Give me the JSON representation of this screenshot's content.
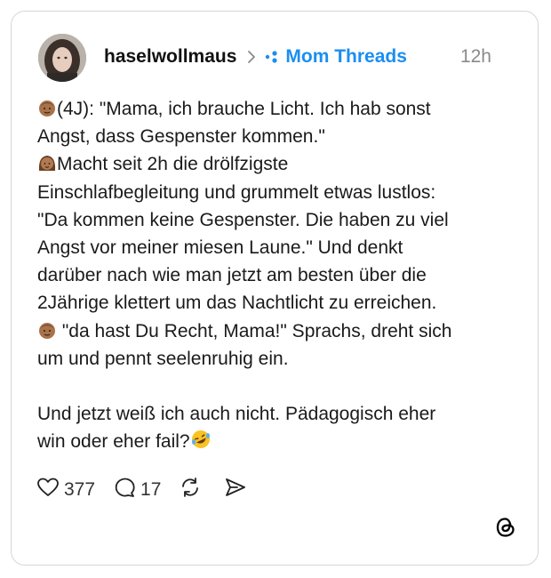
{
  "post": {
    "username": "haselwollmaus",
    "topic": "Mom Threads",
    "time": "12h",
    "text": {
      "l1": "(4J): \"Mama, ich brauche Licht. Ich hab sonst",
      "l2": "Angst, dass Gespenster kommen.\"",
      "l3": "Macht seit 2h die drölfzigste",
      "l4": "Einschlafbegleitung und grummelt etwas lustlos:",
      "l5": "\"Da kommen keine Gespenster. Die haben zu viel",
      "l6": "Angst vor meiner miesen Laune.\" Und denkt",
      "l7": "darüber nach wie man jetzt am besten über die",
      "l8": "2Jährige klettert um das Nachtlicht zu erreichen.",
      "l9": " \"da hast Du Recht, Mama!\" Sprachs, dreht sich",
      "l10": "um und pennt seelenruhig ein.",
      "l11": "Und jetzt weiß ich auch nicht. Pädagogisch eher",
      "l12": "win oder eher fail?"
    },
    "likes": "377",
    "replies": "17"
  },
  "icons": {
    "chevron": "chevron-right-icon",
    "topic": "topic-dots-icon",
    "like": "heart-icon",
    "reply": "comment-icon",
    "repost": "repost-icon",
    "share": "send-icon",
    "logo": "threads-logo-icon",
    "emojis": [
      "boy-face-emoji",
      "woman-face-emoji",
      "rofl-emoji"
    ]
  },
  "colors": {
    "topic": "#1b8ef2",
    "muted": "#8a8a8a",
    "text": "#1a1a1a"
  }
}
